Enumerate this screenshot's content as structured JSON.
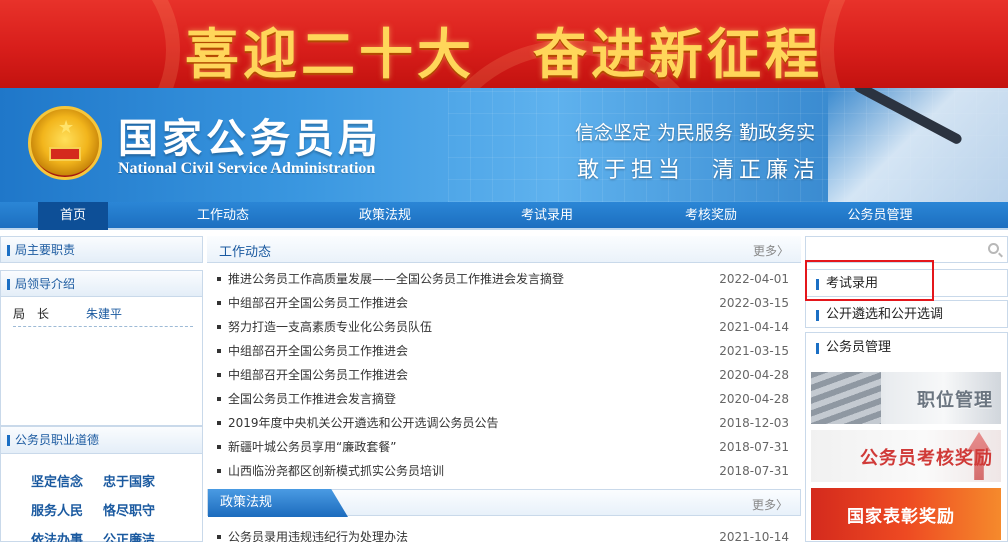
{
  "banner": {
    "title": "喜迎二十大　奋进新征程"
  },
  "header": {
    "org_cn": "国家公务员局",
    "org_en": "National Civil Service Administration",
    "slogan_line1": "信念坚定 为民服务 勤政务实",
    "slogan_line2": "敢于担当　清正廉洁",
    "emblem_icon": "national-emblem-icon"
  },
  "nav": {
    "items": [
      {
        "label": "首页",
        "active": true
      },
      {
        "label": "工作动态"
      },
      {
        "label": "政策法规"
      },
      {
        "label": "考试录用"
      },
      {
        "label": "考核奖励"
      },
      {
        "label": "公务员管理"
      }
    ]
  },
  "left": {
    "duties_title": "局主要职责",
    "leaders_title": "局领导介绍",
    "leader": {
      "role": "局　长",
      "name": "朱建平"
    },
    "ethics_title": "公务员职业道德",
    "ethics": [
      "坚定信念",
      "忠于国家",
      "服务人民",
      "恪尽职守",
      "依法办事",
      "公正廉洁"
    ]
  },
  "main": {
    "section1": {
      "title": "工作动态",
      "more": "更多〉",
      "items": [
        {
          "title": "推进公务员工作高质量发展——全国公务员工作推进会发言摘登",
          "date": "2022-04-01"
        },
        {
          "title": "中组部召开全国公务员工作推进会",
          "date": "2022-03-15"
        },
        {
          "title": "努力打造一支高素质专业化公务员队伍",
          "date": "2021-04-14"
        },
        {
          "title": "中组部召开全国公务员工作推进会",
          "date": "2021-03-15"
        },
        {
          "title": "中组部召开全国公务员工作推进会",
          "date": "2020-04-28"
        },
        {
          "title": "全国公务员工作推进会发言摘登",
          "date": "2020-04-28"
        },
        {
          "title": "2019年度中央机关公开遴选和公开选调公务员公告",
          "date": "2018-12-03"
        },
        {
          "title": "新疆叶城公务员享用“廉政套餐”",
          "date": "2018-07-31"
        },
        {
          "title": "山西临汾尧都区创新模式抓实公务员培训",
          "date": "2018-07-31"
        }
      ]
    },
    "section2": {
      "title": "政策法规",
      "more": "更多〉",
      "items": [
        {
          "title": "公务员录用违规违纪行为处理办法",
          "date": "2021-10-14"
        }
      ]
    }
  },
  "right": {
    "search": {
      "value": "",
      "placeholder": ""
    },
    "links": [
      "考试录用",
      "公开遴选和公开选调"
    ],
    "management_title": "公务员管理",
    "banners": [
      "职位管理",
      "公务员考核奖励",
      "国家表彰奖励"
    ]
  },
  "colors": {
    "banner_red": "#d81e1b",
    "banner_gold": "#ffd65a",
    "nav_blue": "#1c6fc0",
    "nav_active": "#0d4f97",
    "link_blue": "#1b5aa0",
    "highlight_red": "#e4161b"
  }
}
